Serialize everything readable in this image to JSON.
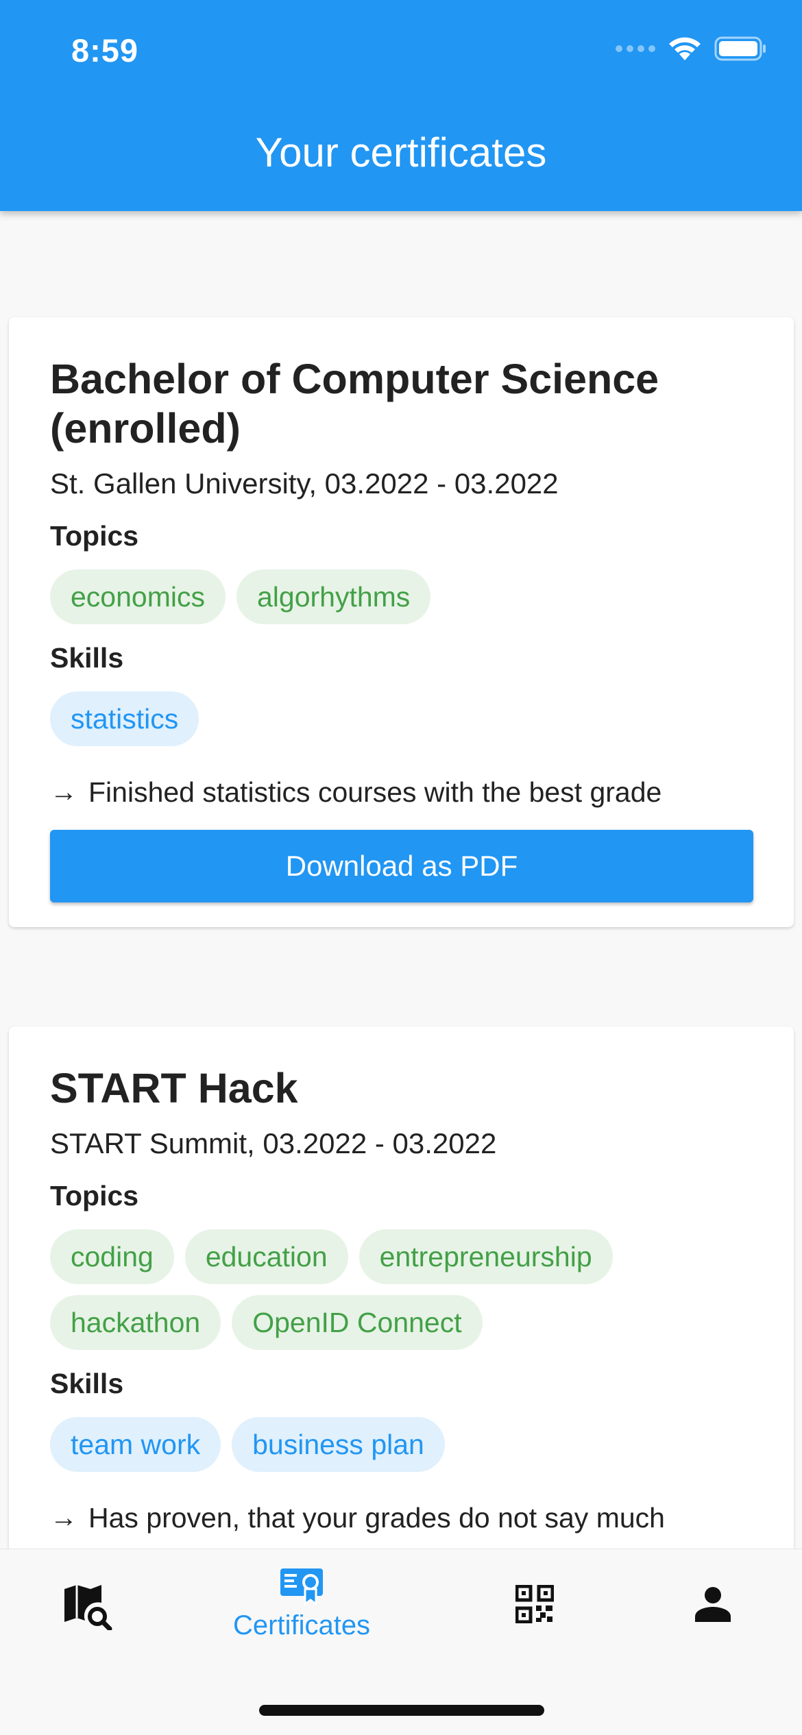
{
  "status_bar": {
    "time": "8:59"
  },
  "app_bar": {
    "title": "Your certificates"
  },
  "certificates": [
    {
      "title": "Bachelor of Computer Science (enrolled)",
      "subtitle": "St. Gallen University, 03.2022 - 03.2022",
      "topics_label": "Topics",
      "topics": [
        "economics",
        "algorhythms"
      ],
      "skills_label": "Skills",
      "skills": [
        "statistics"
      ],
      "note": "Finished statistics courses with the best grade",
      "button_label": "Download as PDF"
    },
    {
      "title": "START Hack",
      "subtitle": "START Summit, 03.2022 - 03.2022",
      "topics_label": "Topics",
      "topics": [
        "coding",
        "education",
        "entrepreneurship",
        "hackathon",
        "OpenID Connect"
      ],
      "skills_label": "Skills",
      "skills": [
        "team work",
        "business plan"
      ],
      "note": "Has proven, that your grades do not say much"
    }
  ],
  "bottom_nav": {
    "items": [
      {
        "icon": "map-search-icon",
        "label": ""
      },
      {
        "icon": "certificate-icon",
        "label": "Certificates",
        "active": true
      },
      {
        "icon": "qr-code-icon",
        "label": ""
      },
      {
        "icon": "person-icon",
        "label": ""
      }
    ],
    "active_color": "#2196f3"
  },
  "colors": {
    "primary": "#2196f3",
    "topic_chip_bg": "#e7f3e6",
    "topic_chip_text": "#43a047",
    "skill_chip_bg": "#e0f0fd"
  }
}
